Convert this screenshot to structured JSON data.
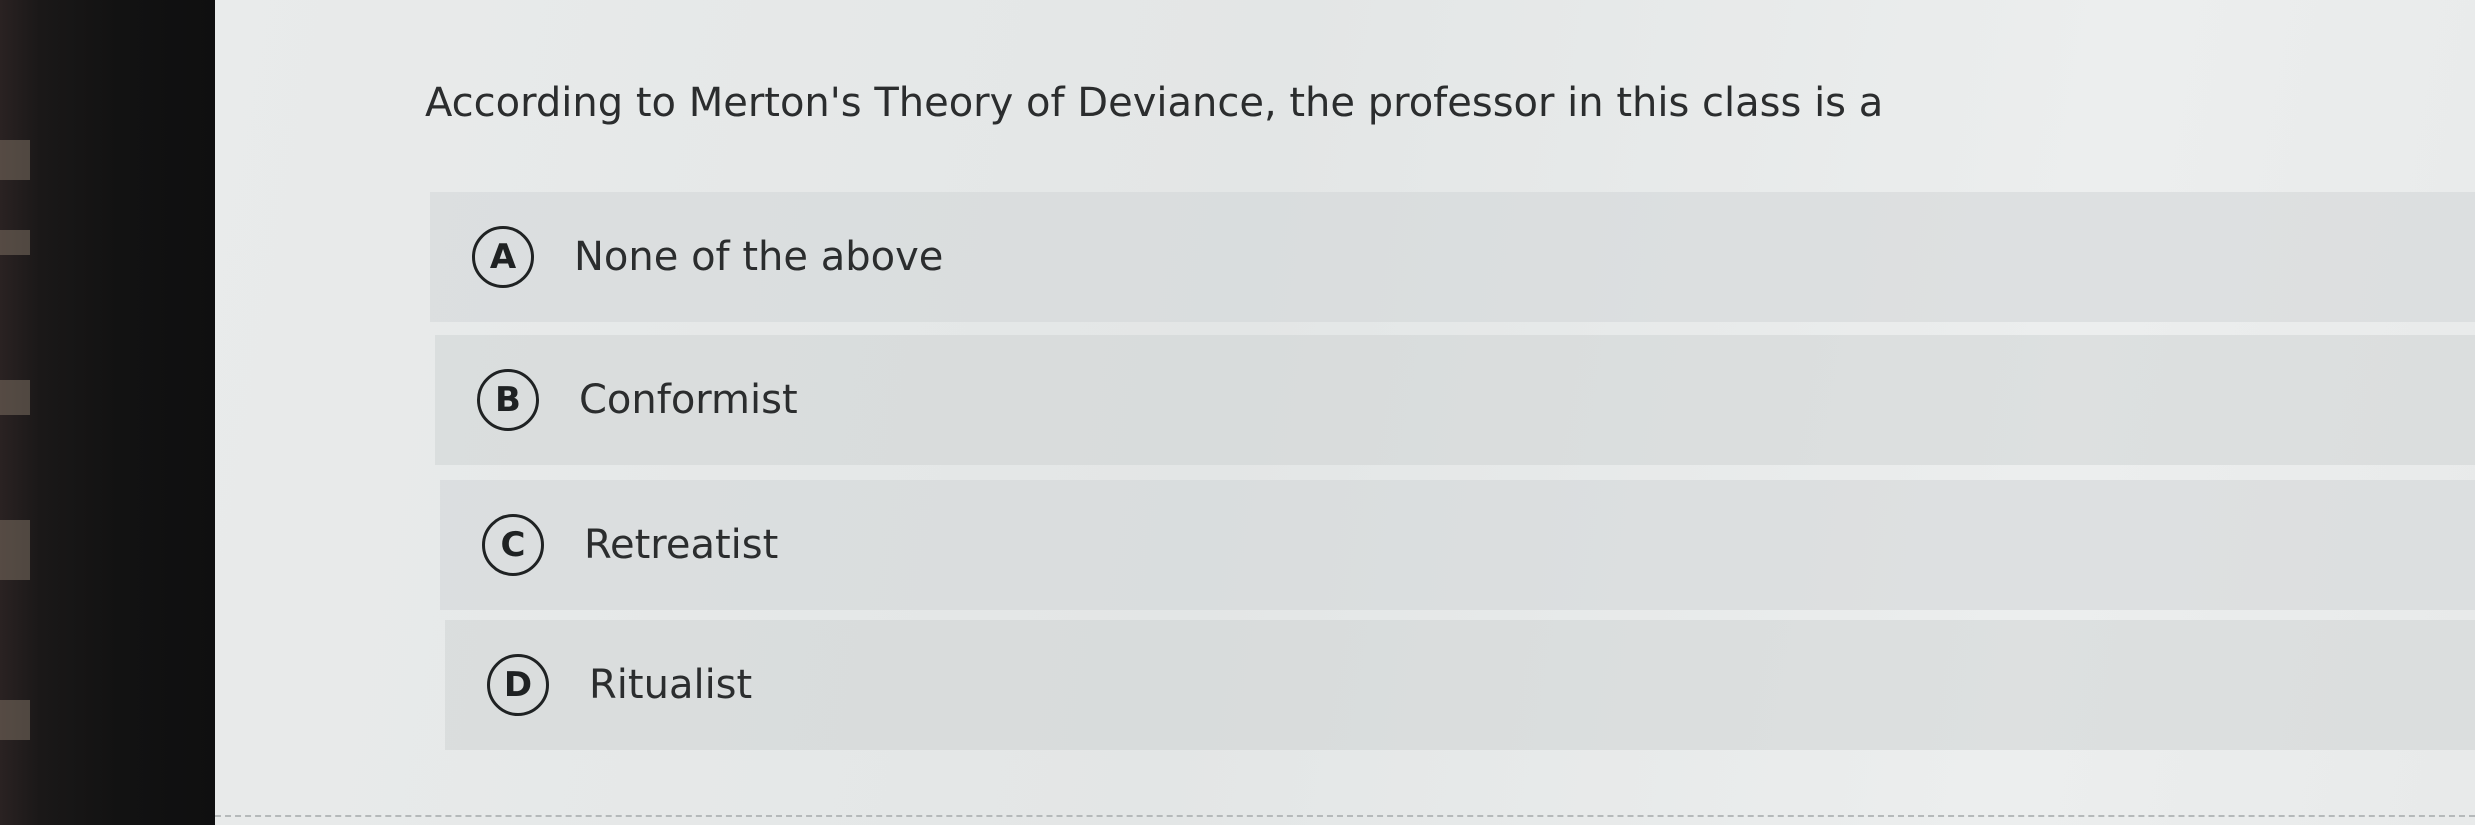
{
  "question": {
    "text": "According to Merton's Theory of Deviance, the professor in this class is a"
  },
  "options": [
    {
      "letter": "A",
      "label": "None of the above"
    },
    {
      "letter": "B",
      "label": "Conformist"
    },
    {
      "letter": "C",
      "label": "Retreatist"
    },
    {
      "letter": "D",
      "label": "Ritualist"
    }
  ],
  "colors": {
    "page_background": "#e6e8e8",
    "option_background": "#d2d6d7",
    "text": "#2b2d2e",
    "bezel": "#121212"
  }
}
